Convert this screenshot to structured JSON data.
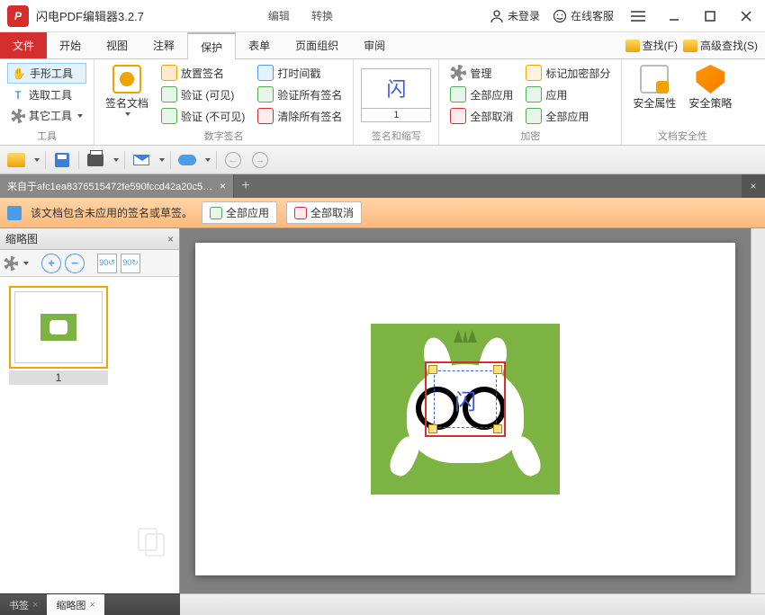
{
  "app": {
    "title": "闪电PDF编辑器3.2.7"
  },
  "sub_tabs": {
    "edit": "编辑",
    "convert": "转换"
  },
  "titlebar": {
    "login": "未登录",
    "support": "在线客服"
  },
  "menu": {
    "file": "文件",
    "start": "开始",
    "view": "视图",
    "comment": "注释",
    "protect": "保护",
    "form": "表单",
    "organize": "页面组织",
    "review": "审阅",
    "find": "查找(F)",
    "advfind": "高级查找(S)"
  },
  "ribbon": {
    "tools": {
      "hand": "手形工具",
      "select": "选取工具",
      "other": "其它工具",
      "label": "工具"
    },
    "sign": {
      "doc": "签名文档",
      "place": "放置签名",
      "verify_vis": "验证 (可见)",
      "verify_invis": "验证 (不可见)",
      "timestamp": "打时间戳",
      "verify_all": "验证所有签名",
      "clear_all": "清除所有签名",
      "preview_num": "1",
      "label": "数字签名",
      "label2": "签名和缩写"
    },
    "encrypt": {
      "manage": "管理",
      "apply_all": "全部应用",
      "cancel_all": "全部取消",
      "mark": "标记加密部分",
      "apply": "应用",
      "apply_all2": "全部应用",
      "label": "加密"
    },
    "security": {
      "props": "安全属性",
      "policy": "安全策略",
      "label": "文档安全性"
    }
  },
  "doc_tab": {
    "name": "来自于afc1ea8376515472fe590fccd42a20c5_resi.. *"
  },
  "notice": {
    "text": "该文档包含未应用的签名或草签。",
    "apply_all": "全部应用",
    "cancel_all": "全部取消"
  },
  "sidebar": {
    "title": "缩略图",
    "thumb_num": "1",
    "tab_bookmark": "书签",
    "tab_thumb": "缩略图"
  },
  "signature_text": "闪"
}
